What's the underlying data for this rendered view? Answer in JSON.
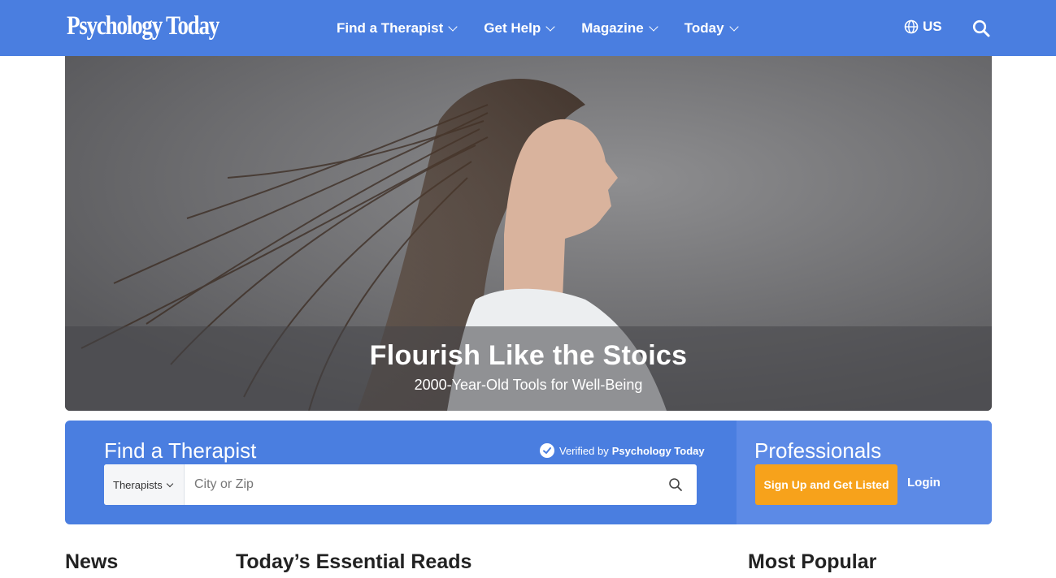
{
  "header": {
    "logo": "Psychology Today",
    "nav": [
      {
        "label": "Find a Therapist"
      },
      {
        "label": "Get Help"
      },
      {
        "label": "Magazine"
      },
      {
        "label": "Today"
      }
    ],
    "region": "US",
    "icons": {
      "region": "globe-icon",
      "search": "search-icon"
    },
    "color": "#4a7ee0"
  },
  "hero": {
    "title": "Flourish Like the Stoics",
    "subtitle": "2000-Year-Old Tools for Well-Being"
  },
  "finder": {
    "title": "Find a Therapist",
    "verified_prefix": "Verified by",
    "verified_brand": "Psychology Today",
    "type_select": "Therapists",
    "city_placeholder": "City or Zip"
  },
  "professionals": {
    "title": "Professionals",
    "signup_label": "Sign Up and Get Listed",
    "login_label": "Login",
    "button_color": "#f7a21b"
  },
  "sections": {
    "news": "News",
    "essential": "Today’s Essential Reads",
    "popular": "Most Popular"
  }
}
